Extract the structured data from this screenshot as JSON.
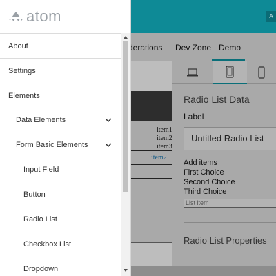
{
  "brand": {
    "name": "atom",
    "icon": "atom-logo-icon"
  },
  "topbar": {
    "badge": "A"
  },
  "nav": {
    "items": [
      "derations",
      "Dev Zone",
      "Demo"
    ]
  },
  "device_tabs": [
    "laptop-icon",
    "tablet-icon",
    "mobile-icon"
  ],
  "canvas": {
    "items": [
      {
        "label": "item1",
        "color": "#111111"
      },
      {
        "label": "item2",
        "color": "#111111"
      },
      {
        "label": "item3",
        "color": "#111111"
      },
      {
        "label": "item2",
        "color": "#1b5e87"
      }
    ]
  },
  "properties": {
    "title": "Radio List Data",
    "label_caption": "Label",
    "label_value": "Untitled Radio List",
    "add_items_caption": "Add items",
    "choices": [
      "First Choice",
      "Second Choice",
      "Third Choice"
    ],
    "list_item_placeholder": "List item",
    "section2_title": "Radio List Properties"
  },
  "sidebar": {
    "items": [
      {
        "label": "About",
        "level": 0
      },
      {
        "label": "Settings",
        "level": 0
      },
      {
        "label": "Elements",
        "level": 0
      },
      {
        "label": "Data Elements",
        "level": 1,
        "expandable": true
      },
      {
        "label": "Form Basic Elements",
        "level": 1,
        "expandable": true
      },
      {
        "label": "Input Field",
        "level": 2
      },
      {
        "label": "Button",
        "level": 2
      },
      {
        "label": "Radio List",
        "level": 2
      },
      {
        "label": "Checkbox List",
        "level": 2
      },
      {
        "label": "Dropdown",
        "level": 2
      }
    ]
  },
  "colors": {
    "accent": "#0e8a96",
    "overlay": "#a9a9a9"
  }
}
